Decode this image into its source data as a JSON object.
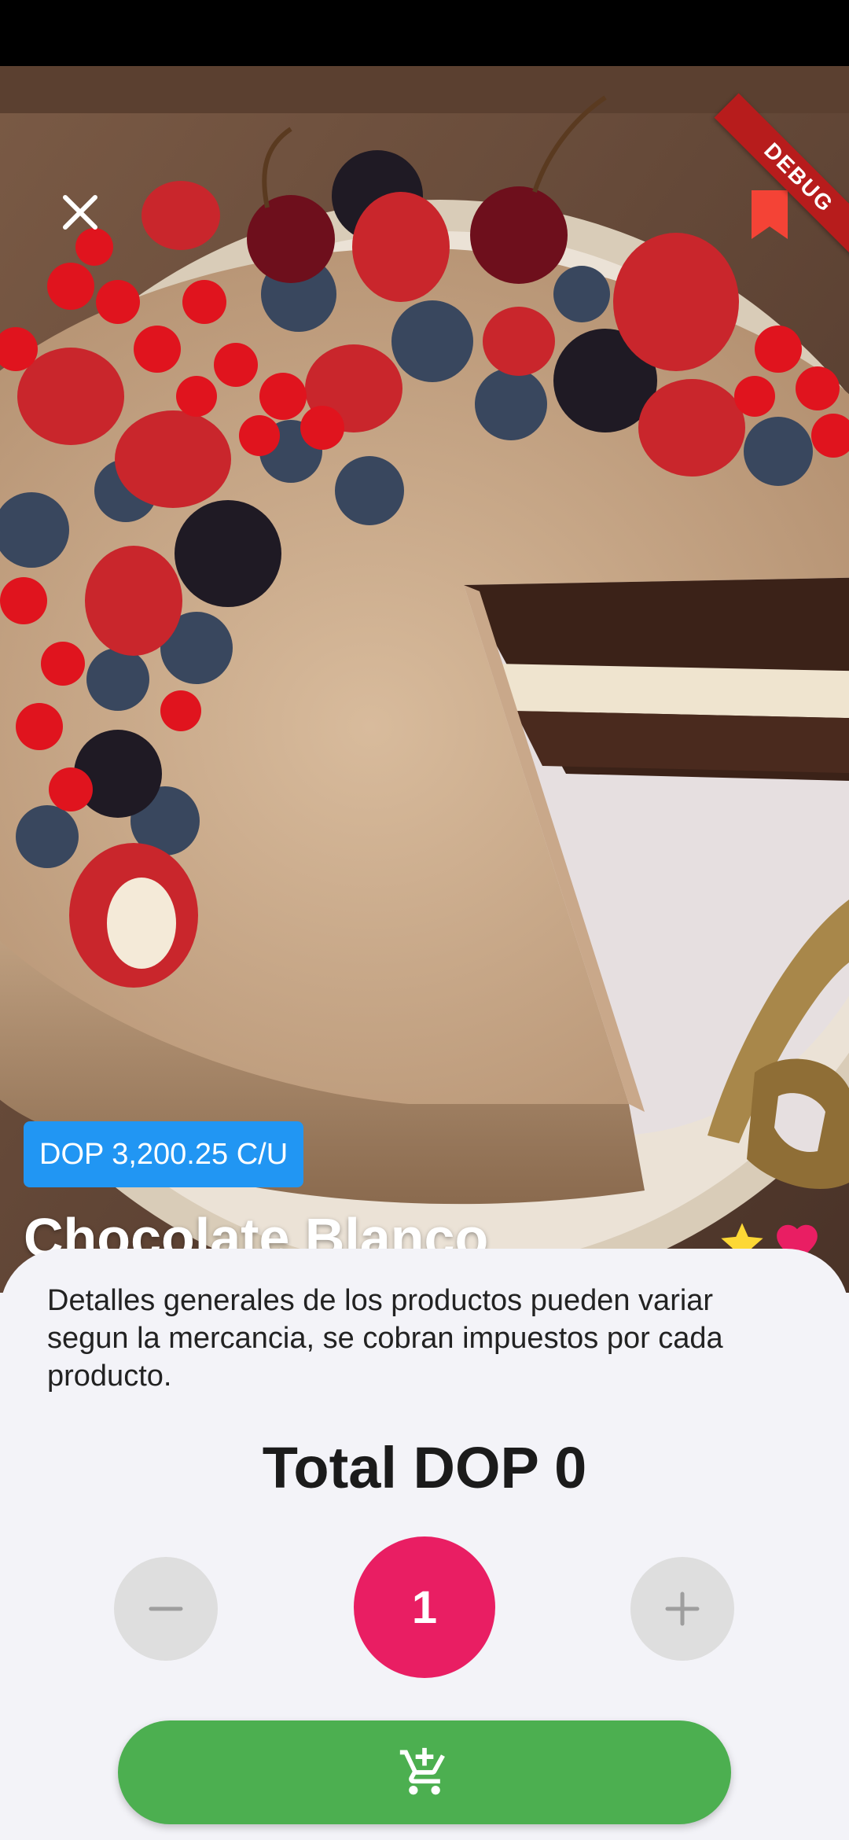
{
  "status_bar": {},
  "debug_banner": "DEBUG",
  "product": {
    "price_label": "DOP 3,200.25 C/U",
    "title": "Chocolate Blanco",
    "description": "Detalles generales de los productos pueden variar segun la mercancia, se cobran impuestos por cada producto.",
    "image_icon": "cake-photo"
  },
  "order": {
    "total_label": "Total DOP 0",
    "quantity": "1"
  },
  "icons": {
    "close": "close-icon",
    "bookmark": "bookmark-icon",
    "rating": "star-icon",
    "favorite": "heart-icon",
    "minus": "minus-icon",
    "plus": "plus-icon",
    "add_to_cart": "add-shopping-cart-icon"
  },
  "colors": {
    "price_badge": "#2196f3",
    "quantity_circle": "#e91e63",
    "add_to_cart": "#4caf50",
    "favorite": "#e91e63",
    "rating": "#fdd835",
    "bookmark": "#f44336",
    "debug": "#b71c1c"
  }
}
